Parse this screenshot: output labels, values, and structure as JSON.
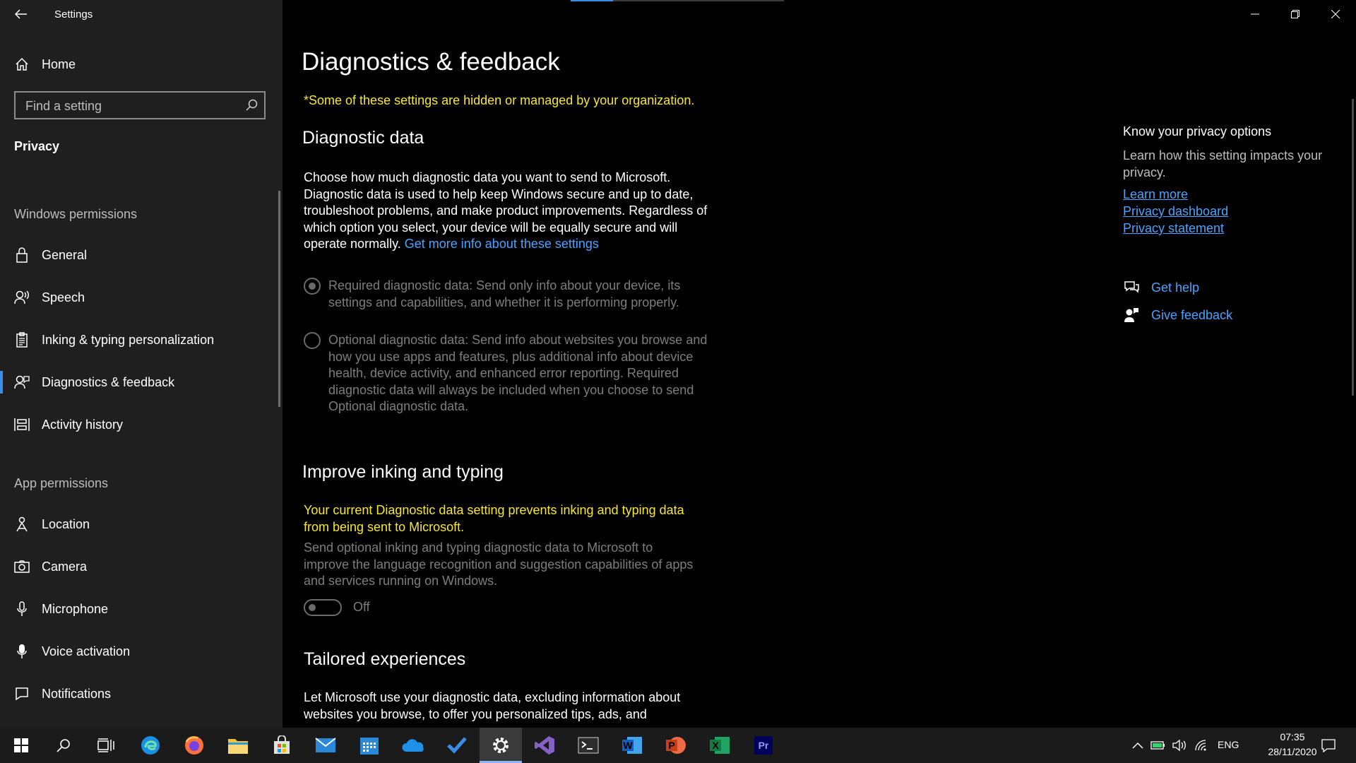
{
  "window": {
    "title": "Settings",
    "minimize_label": "Minimize",
    "restore_label": "Restore",
    "close_label": "Close"
  },
  "sidebar": {
    "home_label": "Home",
    "search_placeholder": "Find a setting",
    "section_title": "Privacy",
    "windows_permissions_label": "Windows permissions",
    "windows_items": [
      {
        "label": "General",
        "icon": "lock-icon"
      },
      {
        "label": "Speech",
        "icon": "speech-icon"
      },
      {
        "label": "Inking & typing personalization",
        "icon": "clipboard-icon"
      },
      {
        "label": "Diagnostics & feedback",
        "icon": "diagnostics-icon",
        "selected": true
      },
      {
        "label": "Activity history",
        "icon": "activity-history-icon"
      }
    ],
    "app_permissions_label": "App permissions",
    "app_items": [
      {
        "label": "Location",
        "icon": "location-icon"
      },
      {
        "label": "Camera",
        "icon": "camera-icon"
      },
      {
        "label": "Microphone",
        "icon": "microphone-icon"
      },
      {
        "label": "Voice activation",
        "icon": "voice-activation-icon"
      },
      {
        "label": "Notifications",
        "icon": "notifications-icon"
      }
    ]
  },
  "main": {
    "page_title": "Diagnostics & feedback",
    "managed_note": "*Some of these settings are hidden or managed by your organization.",
    "diagnostic_data": {
      "heading": "Diagnostic data",
      "description": "Choose how much diagnostic data you want to send to Microsoft. Diagnostic data is used to help keep Windows secure and up to date, troubleshoot problems, and make product improvements. Regardless of which option you select, your device will be equally secure and will operate normally.",
      "more_info_link": "Get more info about these settings",
      "option_required": "Required diagnostic data: Send only info about your device, its settings and capabilities, and whether it is performing properly.",
      "option_optional": "Optional diagnostic data: Send info about websites you browse and how you use apps and features, plus additional info about device health, device activity, and enhanced error reporting. Required diagnostic data will always be included when you choose to send Optional diagnostic data.",
      "selected_option": "required"
    },
    "inking": {
      "heading": "Improve inking and typing",
      "warning": "Your current Diagnostic data setting prevents inking and typing data from being sent to Microsoft.",
      "description": "Send optional inking and typing diagnostic data to Microsoft to improve the language recognition and suggestion capabilities of apps and services running on Windows.",
      "toggle_state": "Off"
    },
    "tailored": {
      "heading": "Tailored experiences",
      "description": "Let Microsoft use your diagnostic data, excluding information about websites you browse, to offer you personalized tips, ads, and"
    }
  },
  "right_panel": {
    "title": "Know your privacy options",
    "description": "Learn how this setting impacts your privacy.",
    "links": [
      "Learn more",
      "Privacy dashboard",
      "Privacy statement"
    ],
    "get_help": "Get help",
    "give_feedback": "Give feedback"
  },
  "taskbar": {
    "apps": [
      {
        "name": "start-button"
      },
      {
        "name": "search-button"
      },
      {
        "name": "task-view-button"
      },
      {
        "name": "edge-app"
      },
      {
        "name": "firefox-app"
      },
      {
        "name": "file-explorer-app"
      },
      {
        "name": "store-app"
      },
      {
        "name": "mail-app"
      },
      {
        "name": "calendar-app"
      },
      {
        "name": "onedrive-app"
      },
      {
        "name": "todo-app"
      },
      {
        "name": "settings-app",
        "active": true
      },
      {
        "name": "visual-studio-app"
      },
      {
        "name": "terminal-app"
      },
      {
        "name": "word-app",
        "letter": "W"
      },
      {
        "name": "powerpoint-app",
        "letter": "P"
      },
      {
        "name": "excel-app",
        "letter": "X"
      },
      {
        "name": "premiere-app",
        "letter": "Pr"
      }
    ],
    "language": "ENG",
    "time": "07:35",
    "date": "28/11/2020"
  },
  "colors": {
    "accent": "#3a8ee6",
    "link": "#4aa3ff",
    "warning": "#f7e632",
    "sidebar_bg": "#1f1f1f"
  }
}
